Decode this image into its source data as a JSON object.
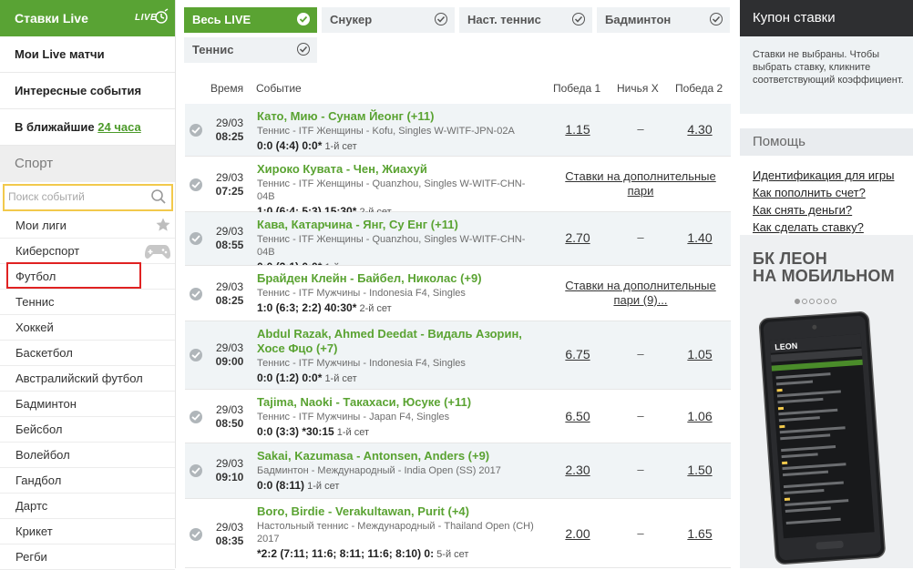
{
  "sidebar": {
    "header": "Ставки Live",
    "logo_text": "LIVE",
    "links": [
      {
        "label": "Мои Live матчи"
      },
      {
        "label": "Интересные события"
      }
    ],
    "upcoming": {
      "prefix": "В ближайшие",
      "highlight": "24 часа"
    },
    "sport_title": "Спорт",
    "search_placeholder": "Поиск событий",
    "sports": [
      {
        "label": "Мои лиги",
        "icon": "star-icon"
      },
      {
        "label": "Киберспорт",
        "icon": "gamepad-icon"
      },
      {
        "label": "Футбол",
        "selected": true
      },
      {
        "label": "Теннис"
      },
      {
        "label": "Хоккей"
      },
      {
        "label": "Баскетбол"
      },
      {
        "label": "Австралийский футбол"
      },
      {
        "label": "Бадминтон"
      },
      {
        "label": "Бейсбол"
      },
      {
        "label": "Волейбол"
      },
      {
        "label": "Гандбол"
      },
      {
        "label": "Дартс"
      },
      {
        "label": "Крикет"
      },
      {
        "label": "Регби"
      }
    ]
  },
  "tabs": [
    {
      "label": "Весь LIVE",
      "active": true
    },
    {
      "label": "Снукер"
    },
    {
      "label": "Наст. теннис"
    },
    {
      "label": "Бадминтон"
    },
    {
      "label": "Теннис"
    }
  ],
  "table": {
    "headers": {
      "time": "Время",
      "event": "Событие",
      "win1": "Победа 1",
      "draw": "Ничья X",
      "win2": "Победа 2"
    },
    "draw_dash": "–",
    "rows": [
      {
        "date": "29/03",
        "time": "08:25",
        "teams": "Като, Мию - Сунам Йеонг (+11)",
        "league": "Теннис - ITF Женщины - Kofu, Singles W-WITF-JPN-02A",
        "score": "0:0 (4:4) 0:0*",
        "set": "1-й сет",
        "win1": "1.15",
        "win2": "4.30"
      },
      {
        "date": "29/03",
        "time": "07:25",
        "teams": "Хироко Кувата - Чен, Жиахуй",
        "league": "Теннис - ITF Женщины - Quanzhou, Singles W-WITF-CHN-04B",
        "score": "1:0 (6:4; 5:3) 15:30*",
        "set": "2-й сет",
        "more": "Ставки на дополнительные пари"
      },
      {
        "date": "29/03",
        "time": "08:55",
        "teams": "Кава, Катарчина - Янг, Су Енг (+11)",
        "league": "Теннис - ITF Женщины - Quanzhou, Singles W-WITF-CHN-04B",
        "score": "0:0 (2:1) 0:0*",
        "set": "1-й сет",
        "win1": "2.70",
        "win2": "1.40"
      },
      {
        "date": "29/03",
        "time": "08:25",
        "teams": "Брайден Клейн - Байбел, Николас (+9)",
        "league": "Теннис - ITF Мужчины - Indonesia F4, Singles",
        "score": "1:0 (6:3; 2:2) 40:30*",
        "set": "2-й сет",
        "more": "Ставки на дополнительные пари (9)..."
      },
      {
        "date": "29/03",
        "time": "09:00",
        "teams": "Abdul Razak, Ahmed Deedat - Видаль Азорин, Хосе Фцо (+7)",
        "league": "Теннис - ITF Мужчины - Indonesia F4, Singles",
        "score": "0:0 (1:2) 0:0*",
        "set": "1-й сет",
        "win1": "6.75",
        "win2": "1.05"
      },
      {
        "date": "29/03",
        "time": "08:50",
        "teams": "Tajima, Naoki - Такахаси, Юсуке (+11)",
        "league": "Теннис - ITF Мужчины - Japan F4, Singles",
        "score": "0:0 (3:3) *30:15",
        "set": "1-й сет",
        "win1": "6.50",
        "win2": "1.06"
      },
      {
        "date": "29/03",
        "time": "09:10",
        "teams": "Sakai, Kazumasa - Antonsen, Anders (+9)",
        "league": "Бадминтон - Международный - India Open (SS) 2017",
        "score": "0:0 (8:11)",
        "set": "1-й сет",
        "win1": "2.30",
        "win2": "1.50"
      },
      {
        "date": "29/03",
        "time": "08:35",
        "teams": "Boro, Birdie - Verakultawan, Purit (+4)",
        "league": "Настольный теннис - Международный - Thailand Open (CH) 2017",
        "score": "*2:2 (7:11; 11:6; 8:11; 11:6; 8:10) 0:",
        "set": "5-й сет",
        "win1": "2.00",
        "win2": "1.65"
      }
    ]
  },
  "coupon": {
    "title": "Купон ставки",
    "text": "Ставки не выбраны. Чтобы выбрать ставку, кликните соответствующий коэффициент."
  },
  "help": {
    "title": "Помощь",
    "links": [
      "Идентификация для игры",
      "Как пополнить счет?",
      "Как снять деньги?",
      "Как сделать ставку?"
    ]
  },
  "promo": {
    "line1": "БК ЛЕОН",
    "line2": "НА МОБИЛЬНОМ",
    "brand": "LEON",
    "slides": 6,
    "active_slide": 1
  },
  "colors": {
    "brand_green": "#5aa332",
    "dark": "#2e2f31",
    "row_alt": "#f0f4f6",
    "highlight_red": "#e02222",
    "search_border": "#f2c94c"
  }
}
